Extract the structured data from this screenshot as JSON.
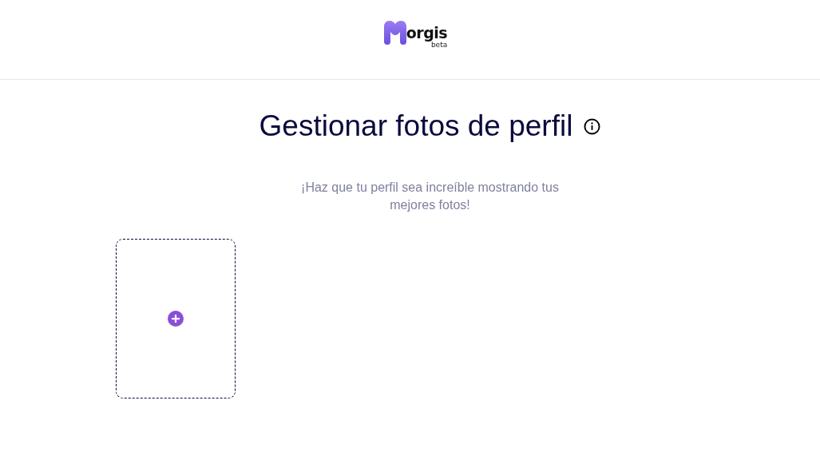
{
  "header": {
    "logo": {
      "text": "orgis",
      "badge": "beta"
    }
  },
  "title": "Gestionar fotos de perfil",
  "subtitle": "¡Haz que tu perfil sea increíble mostrando tus mejores fotos!",
  "photo_slots": [
    {
      "kind": "add"
    }
  ]
}
